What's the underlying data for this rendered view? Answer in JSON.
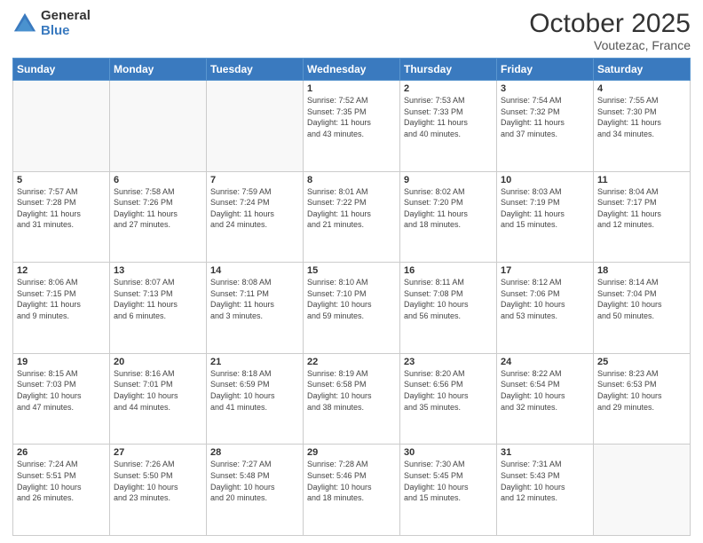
{
  "header": {
    "logo_general": "General",
    "logo_blue": "Blue",
    "month": "October 2025",
    "location": "Voutezac, France"
  },
  "days_of_week": [
    "Sunday",
    "Monday",
    "Tuesday",
    "Wednesday",
    "Thursday",
    "Friday",
    "Saturday"
  ],
  "weeks": [
    [
      {
        "day": "",
        "info": ""
      },
      {
        "day": "",
        "info": ""
      },
      {
        "day": "",
        "info": ""
      },
      {
        "day": "1",
        "info": "Sunrise: 7:52 AM\nSunset: 7:35 PM\nDaylight: 11 hours\nand 43 minutes."
      },
      {
        "day": "2",
        "info": "Sunrise: 7:53 AM\nSunset: 7:33 PM\nDaylight: 11 hours\nand 40 minutes."
      },
      {
        "day": "3",
        "info": "Sunrise: 7:54 AM\nSunset: 7:32 PM\nDaylight: 11 hours\nand 37 minutes."
      },
      {
        "day": "4",
        "info": "Sunrise: 7:55 AM\nSunset: 7:30 PM\nDaylight: 11 hours\nand 34 minutes."
      }
    ],
    [
      {
        "day": "5",
        "info": "Sunrise: 7:57 AM\nSunset: 7:28 PM\nDaylight: 11 hours\nand 31 minutes."
      },
      {
        "day": "6",
        "info": "Sunrise: 7:58 AM\nSunset: 7:26 PM\nDaylight: 11 hours\nand 27 minutes."
      },
      {
        "day": "7",
        "info": "Sunrise: 7:59 AM\nSunset: 7:24 PM\nDaylight: 11 hours\nand 24 minutes."
      },
      {
        "day": "8",
        "info": "Sunrise: 8:01 AM\nSunset: 7:22 PM\nDaylight: 11 hours\nand 21 minutes."
      },
      {
        "day": "9",
        "info": "Sunrise: 8:02 AM\nSunset: 7:20 PM\nDaylight: 11 hours\nand 18 minutes."
      },
      {
        "day": "10",
        "info": "Sunrise: 8:03 AM\nSunset: 7:19 PM\nDaylight: 11 hours\nand 15 minutes."
      },
      {
        "day": "11",
        "info": "Sunrise: 8:04 AM\nSunset: 7:17 PM\nDaylight: 11 hours\nand 12 minutes."
      }
    ],
    [
      {
        "day": "12",
        "info": "Sunrise: 8:06 AM\nSunset: 7:15 PM\nDaylight: 11 hours\nand 9 minutes."
      },
      {
        "day": "13",
        "info": "Sunrise: 8:07 AM\nSunset: 7:13 PM\nDaylight: 11 hours\nand 6 minutes."
      },
      {
        "day": "14",
        "info": "Sunrise: 8:08 AM\nSunset: 7:11 PM\nDaylight: 11 hours\nand 3 minutes."
      },
      {
        "day": "15",
        "info": "Sunrise: 8:10 AM\nSunset: 7:10 PM\nDaylight: 10 hours\nand 59 minutes."
      },
      {
        "day": "16",
        "info": "Sunrise: 8:11 AM\nSunset: 7:08 PM\nDaylight: 10 hours\nand 56 minutes."
      },
      {
        "day": "17",
        "info": "Sunrise: 8:12 AM\nSunset: 7:06 PM\nDaylight: 10 hours\nand 53 minutes."
      },
      {
        "day": "18",
        "info": "Sunrise: 8:14 AM\nSunset: 7:04 PM\nDaylight: 10 hours\nand 50 minutes."
      }
    ],
    [
      {
        "day": "19",
        "info": "Sunrise: 8:15 AM\nSunset: 7:03 PM\nDaylight: 10 hours\nand 47 minutes."
      },
      {
        "day": "20",
        "info": "Sunrise: 8:16 AM\nSunset: 7:01 PM\nDaylight: 10 hours\nand 44 minutes."
      },
      {
        "day": "21",
        "info": "Sunrise: 8:18 AM\nSunset: 6:59 PM\nDaylight: 10 hours\nand 41 minutes."
      },
      {
        "day": "22",
        "info": "Sunrise: 8:19 AM\nSunset: 6:58 PM\nDaylight: 10 hours\nand 38 minutes."
      },
      {
        "day": "23",
        "info": "Sunrise: 8:20 AM\nSunset: 6:56 PM\nDaylight: 10 hours\nand 35 minutes."
      },
      {
        "day": "24",
        "info": "Sunrise: 8:22 AM\nSunset: 6:54 PM\nDaylight: 10 hours\nand 32 minutes."
      },
      {
        "day": "25",
        "info": "Sunrise: 8:23 AM\nSunset: 6:53 PM\nDaylight: 10 hours\nand 29 minutes."
      }
    ],
    [
      {
        "day": "26",
        "info": "Sunrise: 7:24 AM\nSunset: 5:51 PM\nDaylight: 10 hours\nand 26 minutes."
      },
      {
        "day": "27",
        "info": "Sunrise: 7:26 AM\nSunset: 5:50 PM\nDaylight: 10 hours\nand 23 minutes."
      },
      {
        "day": "28",
        "info": "Sunrise: 7:27 AM\nSunset: 5:48 PM\nDaylight: 10 hours\nand 20 minutes."
      },
      {
        "day": "29",
        "info": "Sunrise: 7:28 AM\nSunset: 5:46 PM\nDaylight: 10 hours\nand 18 minutes."
      },
      {
        "day": "30",
        "info": "Sunrise: 7:30 AM\nSunset: 5:45 PM\nDaylight: 10 hours\nand 15 minutes."
      },
      {
        "day": "31",
        "info": "Sunrise: 7:31 AM\nSunset: 5:43 PM\nDaylight: 10 hours\nand 12 minutes."
      },
      {
        "day": "",
        "info": ""
      }
    ]
  ]
}
